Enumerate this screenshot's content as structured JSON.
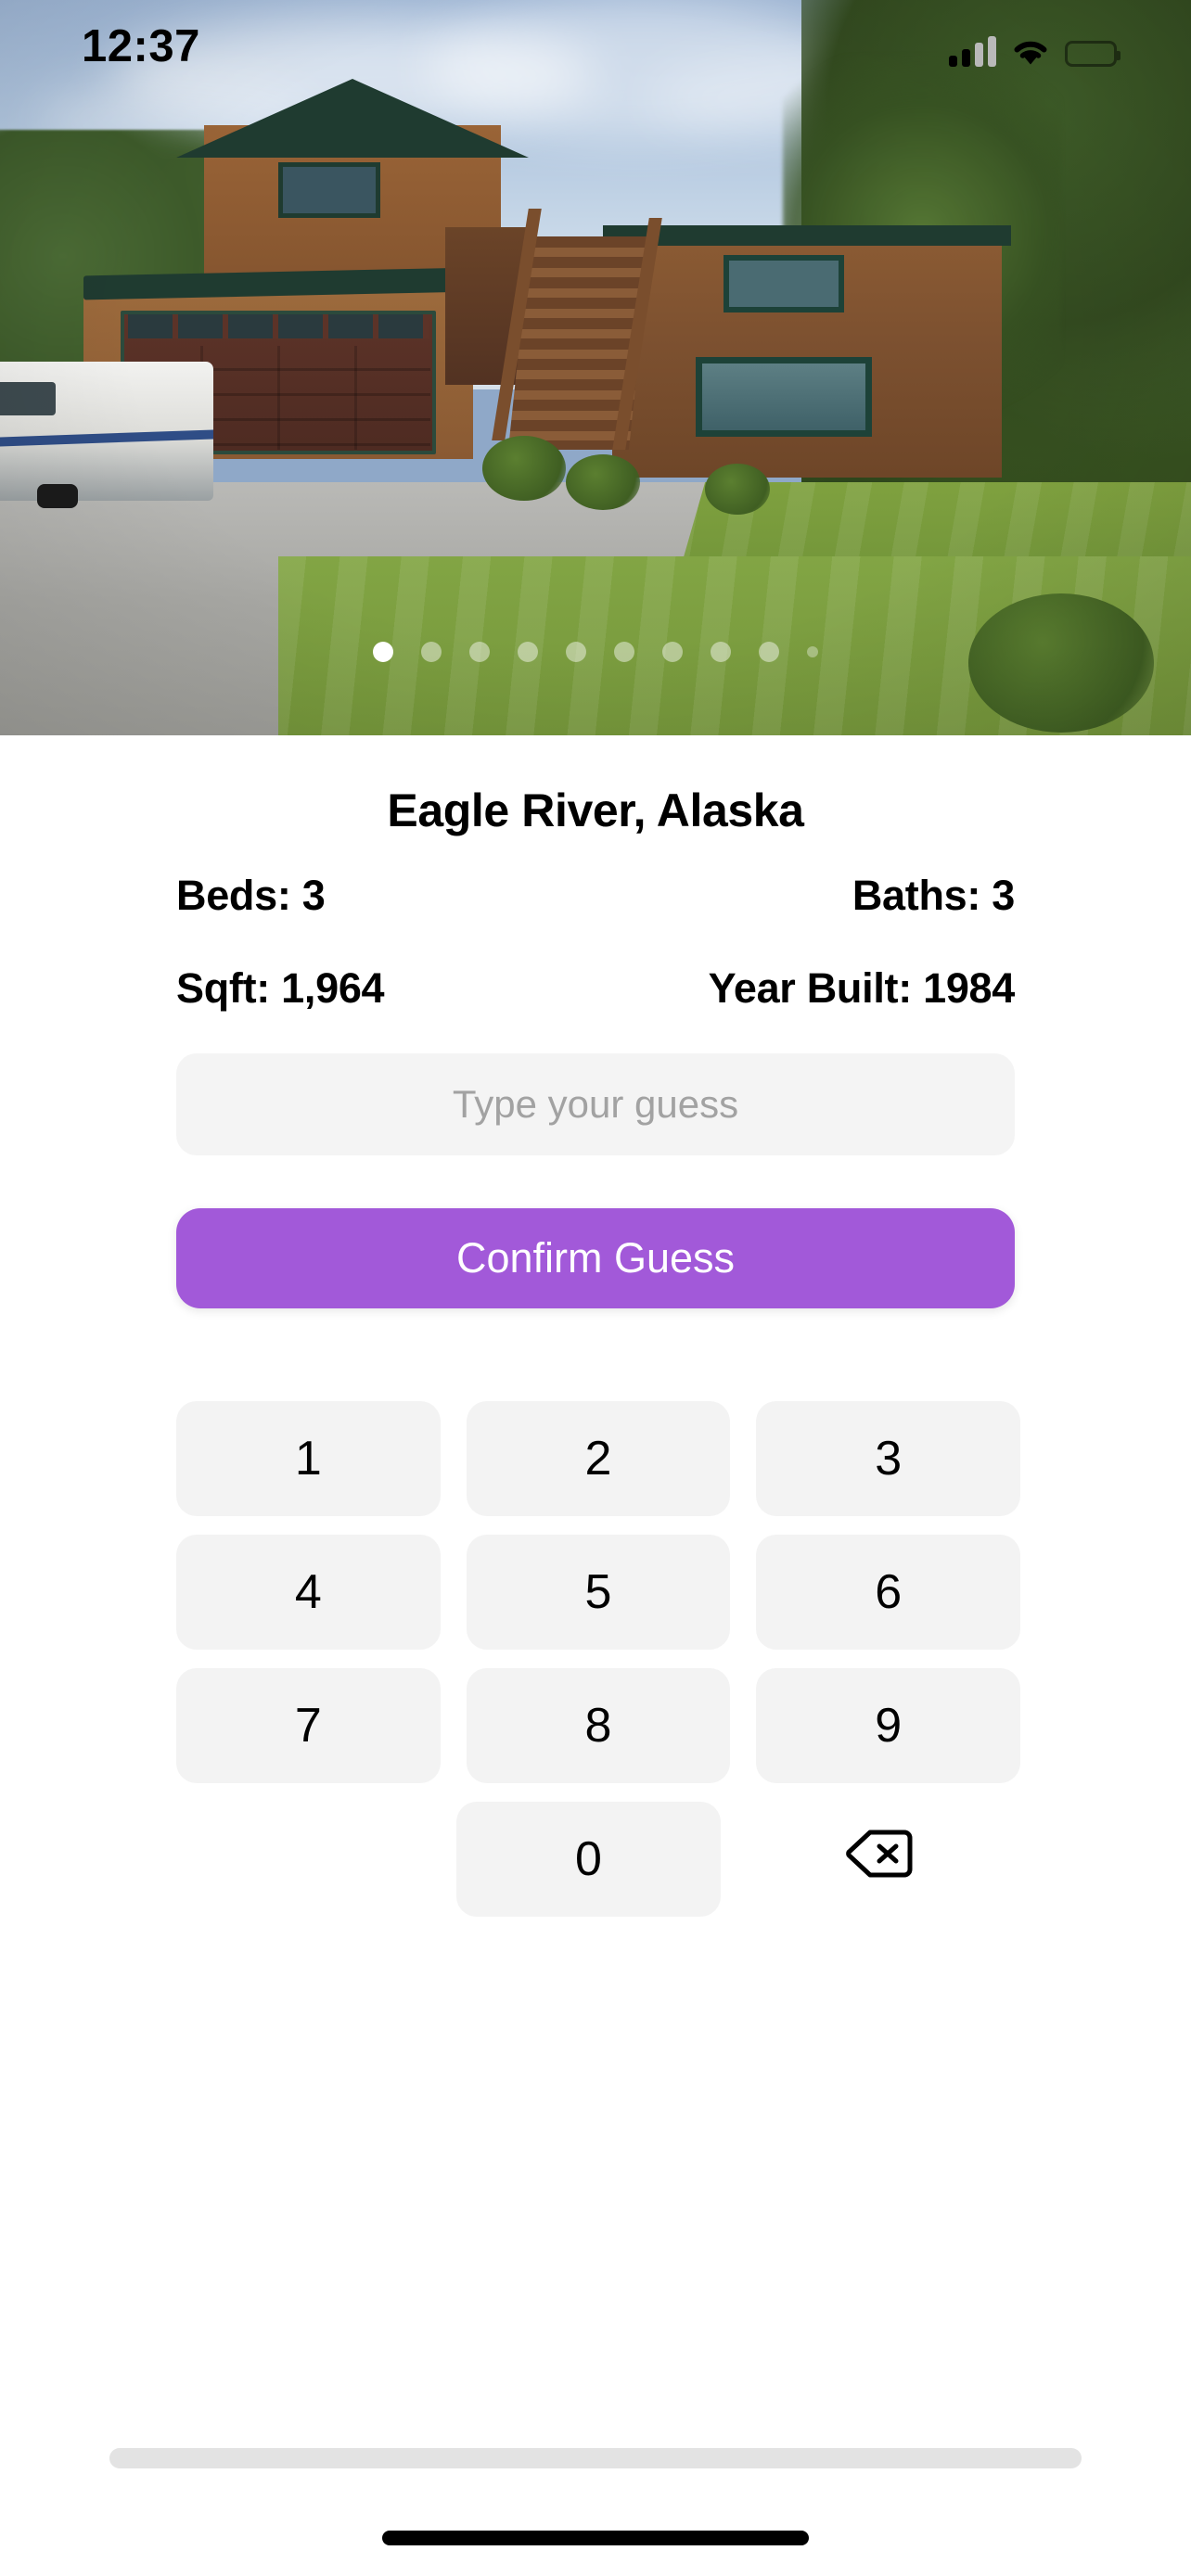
{
  "status_bar": {
    "time": "12:37",
    "cellular_icon": "cellular-signal-icon",
    "cellular_bars_filled": 2,
    "cellular_bars_total": 4,
    "wifi_icon": "wifi-icon",
    "battery_icon": "battery-icon",
    "battery_level_pct": 100
  },
  "hero": {
    "photo_alt": "Two-story wood-sided house with brown garage door, wooden staircase, RV trailer on gravel driveway and green lawn",
    "carousel": {
      "total_dots": 10,
      "active_index": 0
    }
  },
  "listing": {
    "title": "Eagle River, Alaska",
    "stats": [
      {
        "label": "Beds: 3",
        "key": "beds",
        "value": "3"
      },
      {
        "label": "Baths: 3",
        "key": "baths",
        "value": "3"
      },
      {
        "label": "Sqft: 1,964",
        "key": "sqft",
        "value": "1,964"
      },
      {
        "label": "Year Built: 1984",
        "key": "year_built",
        "value": "1984"
      }
    ]
  },
  "guess": {
    "input_value": "",
    "input_placeholder": "Type your guess",
    "confirm_label": "Confirm Guess"
  },
  "keypad": {
    "rows": [
      [
        "1",
        "2",
        "3"
      ],
      [
        "4",
        "5",
        "6"
      ],
      [
        "7",
        "8",
        "9"
      ]
    ],
    "zero_label": "0",
    "backspace_icon": "backspace-delete-icon"
  },
  "colors": {
    "accent_purple": "#a259d9",
    "key_background": "#f3f3f3",
    "input_background": "#f4f4f4",
    "placeholder_text": "#a2a2a2",
    "bottom_bar": "#e3e3e3"
  }
}
